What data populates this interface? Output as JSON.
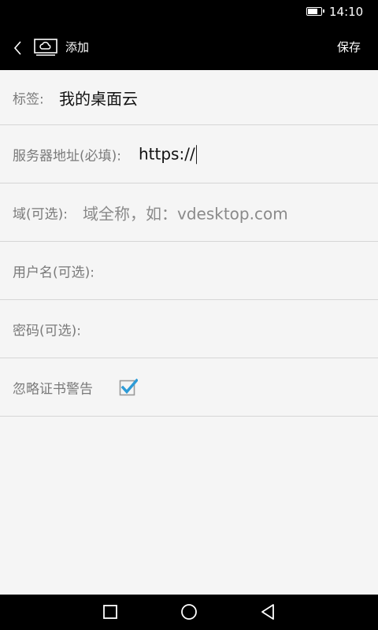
{
  "status_bar": {
    "time": "14:10",
    "battery_level": 0.8
  },
  "action_bar": {
    "icons": {
      "back": "chevron-left-icon",
      "logo": "cloud-desktop-icon"
    },
    "title": "添加",
    "save_label": "保存"
  },
  "form": {
    "label_field": {
      "label": "标签:",
      "value": "我的桌面云"
    },
    "server_field": {
      "label": "服务器地址(必填):",
      "value": "https://"
    },
    "domain_field": {
      "label": "域(可选):",
      "placeholder": "域全称，如：vdesktop.com"
    },
    "username_field": {
      "label": "用户名(可选):",
      "value": ""
    },
    "password_field": {
      "label": "密码(可选):",
      "value": ""
    },
    "ignore_cert": {
      "label": "忽略证书警告",
      "checked": true
    }
  },
  "nav_bar": {
    "icons": [
      "square-recents-icon",
      "circle-home-icon",
      "triangle-back-icon"
    ]
  },
  "colors": {
    "bar_background": "#000000",
    "page_background": "#f5f5f5",
    "divider": "#d6d6d6",
    "checkbox_accent": "#2e9bd6"
  }
}
